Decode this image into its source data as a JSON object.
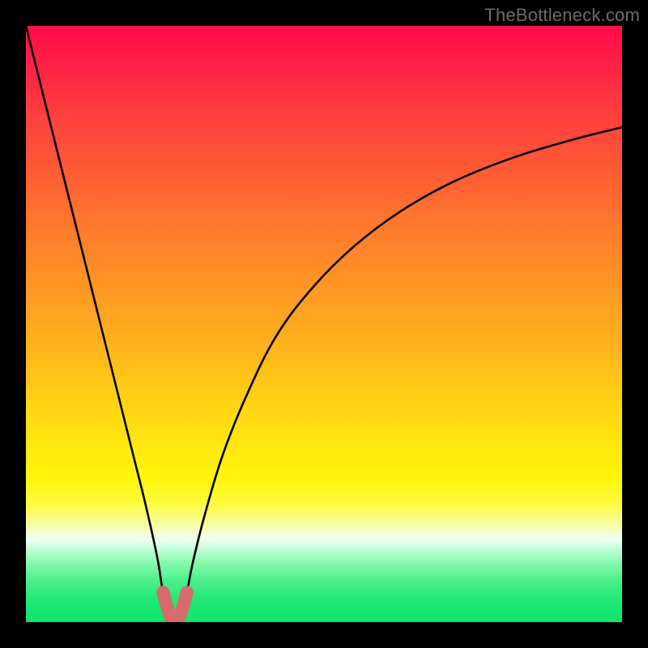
{
  "watermark": "TheBottleneck.com",
  "colors": {
    "background_frame": "#000000",
    "gradient_top": "#ff0a4a",
    "gradient_mid": "#ffe70f",
    "gradient_bottom": "#0be56a",
    "curve": "#000000",
    "marker": "#d66a6d"
  },
  "chart_data": {
    "type": "line",
    "title": "",
    "xlabel": "",
    "ylabel": "",
    "x_range": [
      0,
      100
    ],
    "y_range": [
      0,
      100
    ],
    "axes_visible": false,
    "grid": false,
    "series": [
      {
        "name": "bottleneck-curve",
        "description": "V-shaped curve; y is max (worst, red) at the left, drops to ~0 near x≈25, then rises asymptotically toward the right (red).",
        "x": [
          0,
          3,
          6,
          9,
          12,
          15,
          18,
          20,
          22,
          23,
          24,
          25,
          26,
          27,
          28,
          30,
          33,
          37,
          42,
          48,
          55,
          63,
          72,
          82,
          92,
          100
        ],
        "y": [
          100,
          88,
          76,
          64,
          52,
          40,
          28,
          20,
          11,
          5,
          1.5,
          0,
          1.5,
          5,
          10,
          18,
          28,
          38,
          48,
          56,
          63,
          69,
          74,
          78,
          81,
          83
        ]
      }
    ],
    "markers": {
      "name": "u-shape-highlight",
      "color": "#d66a6d",
      "description": "Thick salmon-colored U shape highlighting the bottom of the curve around x≈23–27, y≈0–5.",
      "points_x": [
        23,
        23.7,
        24.3,
        25,
        25.7,
        26.3,
        27
      ],
      "points_y": [
        5.0,
        2.5,
        0.8,
        0.2,
        0.8,
        2.5,
        5.0
      ]
    },
    "notes": "No numeric axis ticks or labels are shown in the image; values are normalized 0–100. Minimum (best / green) occurs near x≈25."
  }
}
